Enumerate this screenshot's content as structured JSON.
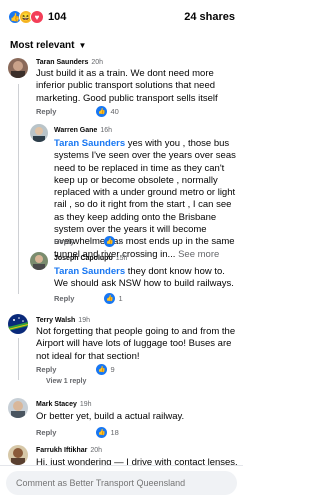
{
  "reactions": {
    "count": "104",
    "shares": "24 shares",
    "icons": [
      "like-icon",
      "haha-icon",
      "love-icon"
    ]
  },
  "sort": {
    "label": "Most relevant"
  },
  "comments": [
    {
      "author": "Taran Saunders",
      "time": "20h",
      "text": "Just build it as a train.  We dont need more inferior public transport solutions that need marketing. Good public transport sells itself",
      "reply": "Reply",
      "likes": "40"
    },
    {
      "author": "Warren Gane",
      "time": "16h",
      "mention": "Taran Saunders",
      "text": " yes with you , those bus systems I've seen over the years over seas need to be replaced in time as they can't keep up or become obsolete , normally replaced with a under ground metro or light rail , so do it right from the start , I can see as they keep adding onto the Brisbane system over the years it will become overwhelmed as most ends up in the same tunnel and river crossing in...",
      "see_more": "See more",
      "reply": "Reply",
      "likes": "2"
    },
    {
      "author": "Joseph Capolupo",
      "time": "15h",
      "mention": "Taran Saunders",
      "text": " they dont know how to. We should ask NSW how to build railways.",
      "reply": "Reply",
      "likes": "1"
    },
    {
      "author": "Terry Walsh",
      "time": "19h",
      "text": "Not forgetting that people going to and from the Airport will have lots of luggage too! Buses are not ideal for that section!",
      "reply": "Reply",
      "likes": "9",
      "view_replies": "View 1 reply"
    },
    {
      "author": "Mark Stacey",
      "time": "19h",
      "text": "Or better yet, build a actual railway.",
      "reply": "Reply",
      "likes": "18"
    },
    {
      "author": "Farrukh Iftikhar",
      "time": "20h",
      "text": "Hi, just wondering — I drive with contact lenses. If I'm"
    }
  ],
  "composer": {
    "placeholder": "Comment as Better Transport Queensland"
  },
  "colors": {
    "accent": "#1877f2",
    "meta": "#65676b",
    "bubble": "#f0f2f5"
  }
}
